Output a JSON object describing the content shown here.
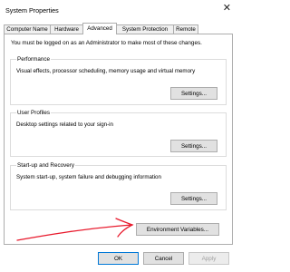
{
  "window": {
    "title": "System Properties"
  },
  "tabs": [
    {
      "label": "Computer Name",
      "active": false
    },
    {
      "label": "Hardware",
      "active": false
    },
    {
      "label": "Advanced",
      "active": true
    },
    {
      "label": "System Protection",
      "active": false
    },
    {
      "label": "Remote",
      "active": false
    }
  ],
  "advanced": {
    "admin_note": "You must be logged on as an Administrator to make most of these changes.",
    "performance": {
      "label": "Performance",
      "description": "Visual effects, processor scheduling, memory usage and virtual memory",
      "button": "Settings..."
    },
    "user_profiles": {
      "label": "User Profiles",
      "description": "Desktop settings related to your sign-in",
      "button": "Settings..."
    },
    "startup_recovery": {
      "label": "Start-up and Recovery",
      "description": "System start-up, system failure and debugging information",
      "button": "Settings..."
    },
    "env_button": "Environment Variables..."
  },
  "footer": {
    "ok": "OK",
    "cancel": "Cancel",
    "apply": "Apply"
  },
  "annotation": {
    "color": "#e8192c"
  }
}
